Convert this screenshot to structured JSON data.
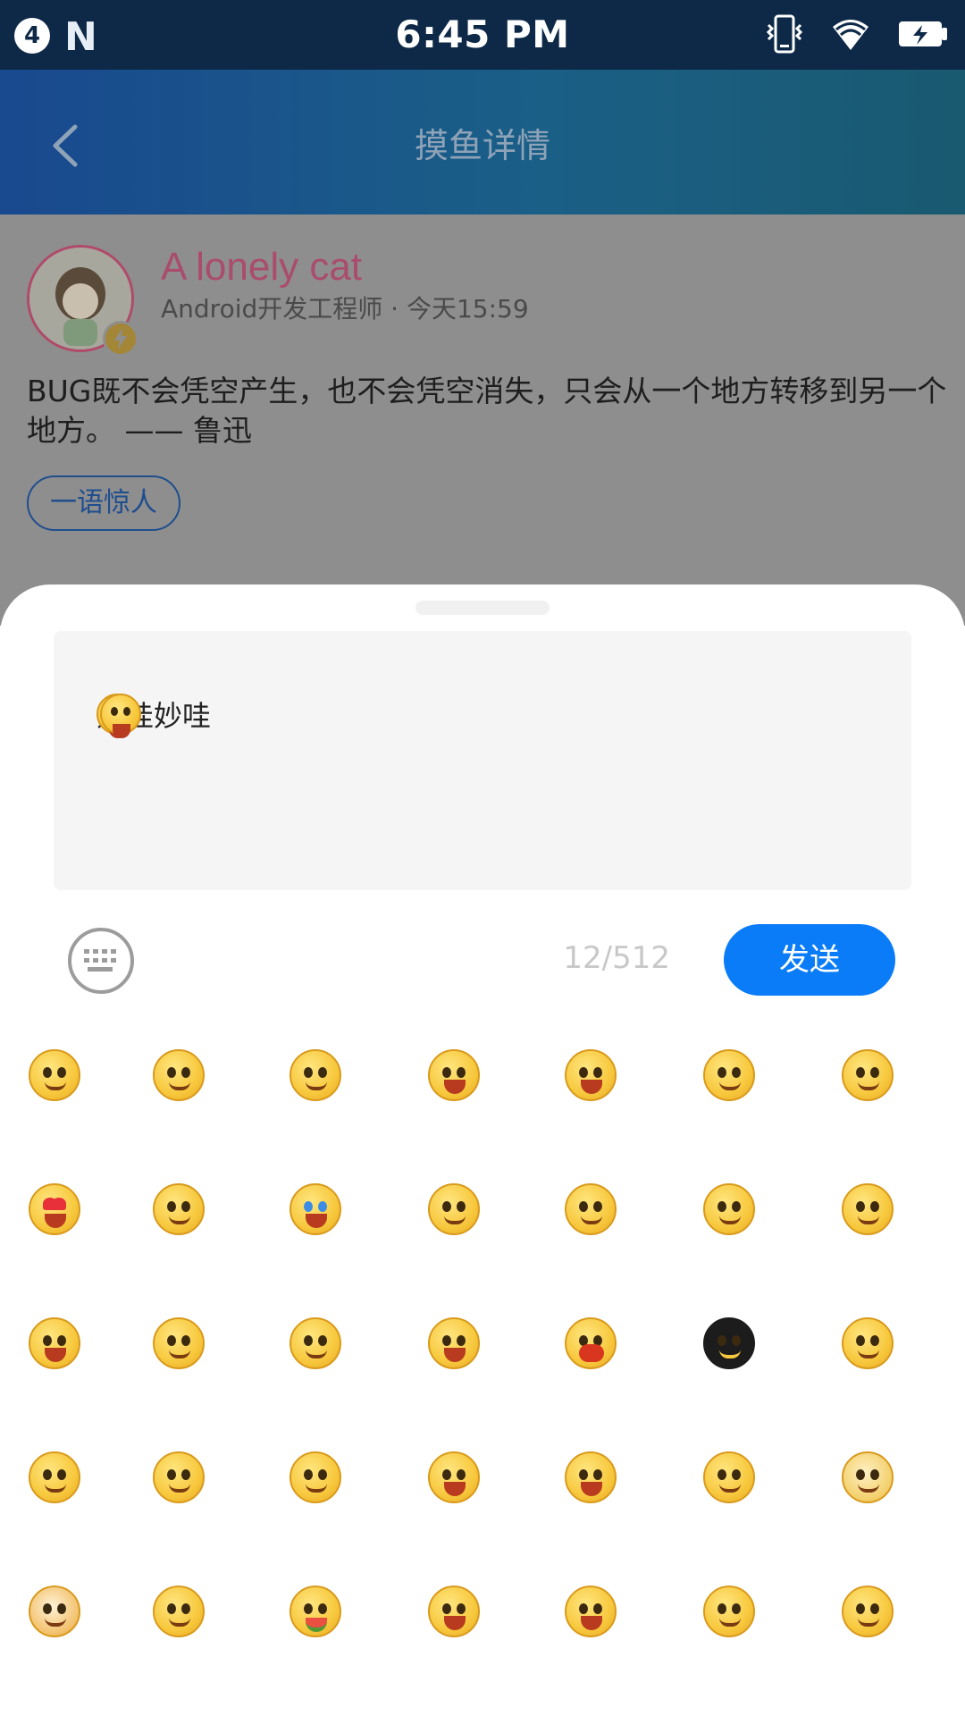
{
  "status_bar": {
    "notification_count": "4",
    "app_icon": "N",
    "time": "6:45 PM",
    "icons": [
      "vibrate-icon",
      "wifi-icon",
      "battery-charging-icon"
    ]
  },
  "app_bar": {
    "back_icon": "chevron-left-icon",
    "title": "摸鱼详情"
  },
  "post": {
    "author_name": "A lonely cat",
    "author_meta": "Android开发工程师 · 今天15:59",
    "content": "BUG既不会凭空产生，也不会凭空消失，只会从一个地方转移到另一个地方。 —— 鲁迅",
    "tag": "一语惊人"
  },
  "composer": {
    "input_text": "妙哇妙哇",
    "input_emojis": [
      "shocked-emoji",
      "shocked-emoji"
    ],
    "counter": "12/512",
    "send_label": "发送",
    "keyboard_icon": "keyboard-icon"
  },
  "emoji_panel": {
    "rows": [
      [
        "smile",
        "grin",
        "ok-hand",
        "starstruck",
        "surprised",
        "smirk",
        "doubt"
      ],
      [
        "heart-eyes",
        "lemon",
        "cry-loud",
        "shy",
        "question",
        "grimace",
        "tongue"
      ],
      [
        "laugh-tears",
        "one-eye",
        "silly",
        "yawn",
        "angry-red",
        "dark-face",
        "facepalm"
      ],
      [
        "old-man",
        "bored",
        "sigh",
        "squint",
        "shocked-hat",
        "sweat-laugh",
        "cat"
      ],
      [
        "doge",
        "content",
        "melon",
        "cheer",
        "scream",
        "pray",
        "sick"
      ]
    ]
  },
  "colors": {
    "status_bar": "#0d2947",
    "app_bar_start": "#19498f",
    "app_bar_end": "#195a70",
    "send_button": "#0a7cf8",
    "author_name": "#aa4c6d"
  }
}
